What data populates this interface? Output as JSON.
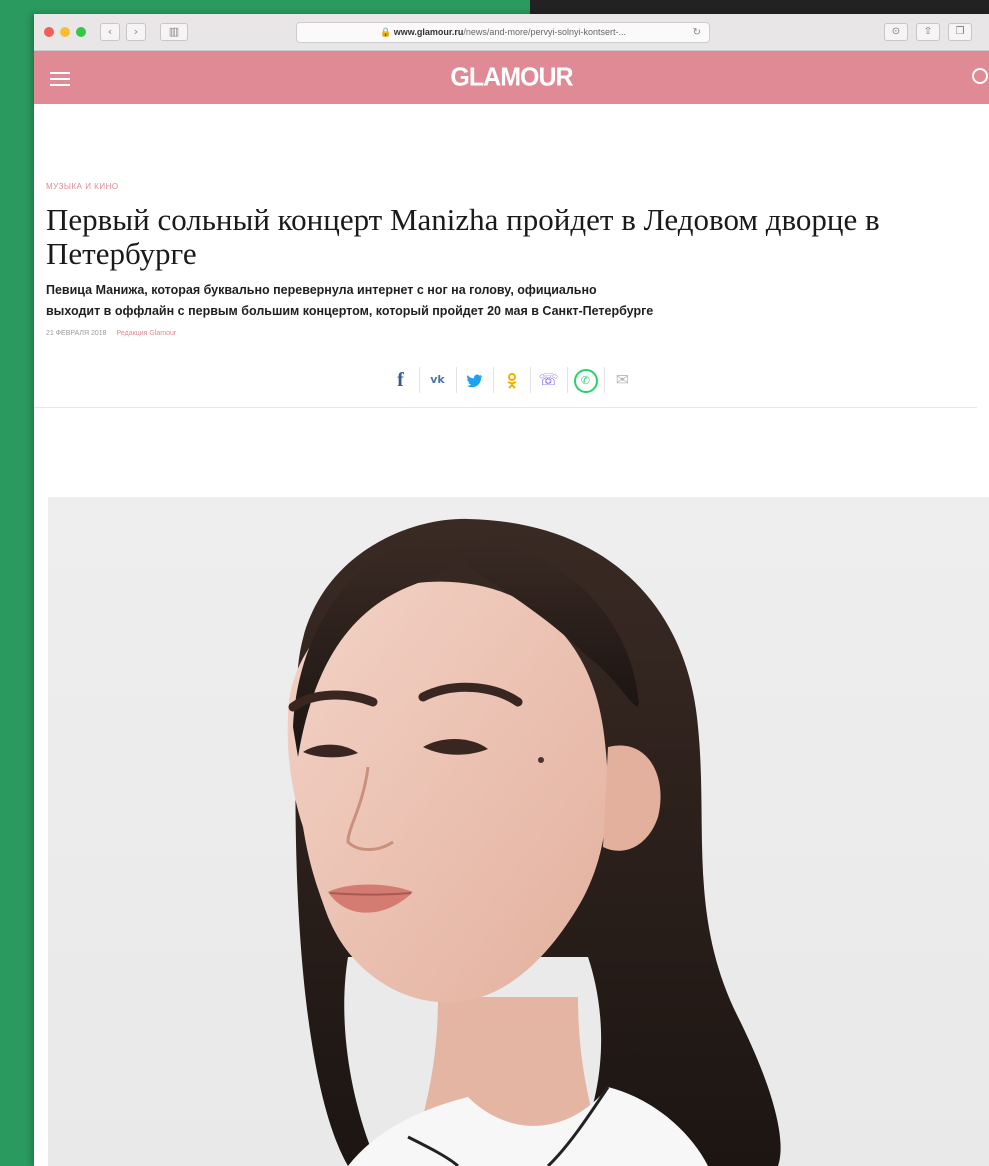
{
  "browser": {
    "url_host": "www.glamour.ru",
    "url_path": "/news/and-more/pervyi-solnyi-kontsert-...",
    "reload_icon": "reload-icon",
    "nav": {
      "back_icon": "chevron-left-icon",
      "forward_icon": "chevron-right-icon",
      "sidebar_icon": "sidebar-icon"
    },
    "buttons": [
      "download-icon",
      "share-icon",
      "tabs-icon"
    ]
  },
  "site": {
    "logo": "GLAMOUR",
    "brand_color": "#df8a94",
    "menu_icon": "hamburger-icon",
    "search_icon": "search-icon"
  },
  "article": {
    "rubric": "МУЗЫКА И КИНО",
    "title": "Первый сольный концерт Manizha пройдет в Ледовом дворце в Петербурге",
    "lead_line1": "Певица Манижа, которая буквально перевернула интернет с ног на голову, официально",
    "lead_line2": "выходит в оффлайн с первым большим концертом, который пройдет 20 мая в Санкт-Петербурге",
    "date": "21 ФЕВРАЛЯ 2018",
    "author": "Редакция Glamour"
  },
  "share": [
    {
      "name": "facebook-icon",
      "glyph": "f"
    },
    {
      "name": "vk-icon",
      "glyph": "vk"
    },
    {
      "name": "twitter-icon",
      "glyph": "🐦"
    },
    {
      "name": "odnoklassniki-icon",
      "glyph": "ok"
    },
    {
      "name": "viber-icon",
      "glyph": "☏"
    },
    {
      "name": "whatsapp-icon",
      "glyph": "✆"
    },
    {
      "name": "email-icon",
      "glyph": "✉"
    }
  ]
}
